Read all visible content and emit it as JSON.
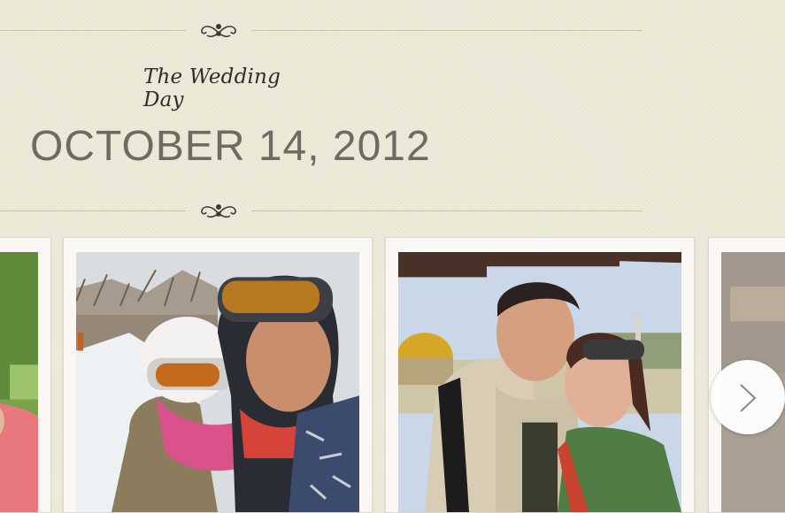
{
  "header": {
    "subtitle": "The Wedding Day",
    "date": "OCTOBER 14, 2012"
  },
  "gallery": {
    "photos": [
      {
        "description_icon": "photo-partial-left"
      },
      {
        "description_icon": "photo-ski-couple"
      },
      {
        "description_icon": "photo-jerusalem-couple"
      },
      {
        "description_icon": "photo-partial-right"
      }
    ],
    "next_button_icon": "chevron-right-icon"
  },
  "colors": {
    "background": "#ece9d6",
    "divider": "#c9c4ac",
    "date_text": "#6f6b63",
    "subtitle_text": "#2f2d28"
  }
}
